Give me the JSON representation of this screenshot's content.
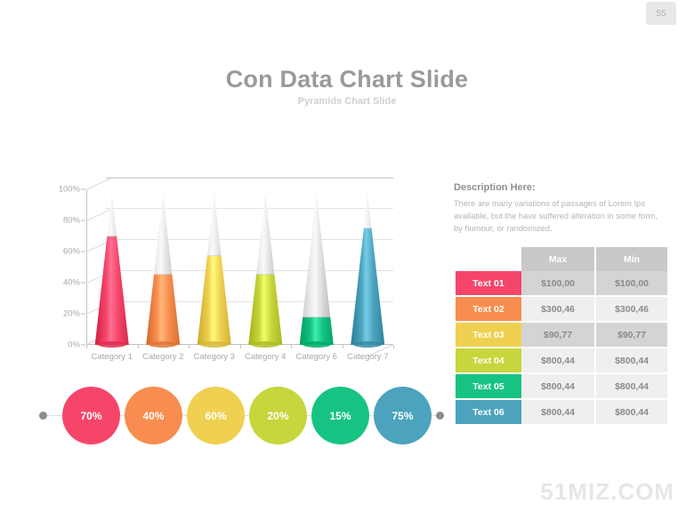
{
  "page_number": "55",
  "title": "Con Data Chart Slide",
  "subtitle": "Pyramids Chart Slide",
  "watermark": "51MIZ.COM",
  "description": {
    "heading": "Description Here:",
    "body": "There are many variations of passages  of Lorem Ips available, but the have suffered alteration in some form, by humour, or randomized."
  },
  "chart_data": {
    "type": "bar",
    "title": "Con Data Chart Slide",
    "subtitle": "Pyramids Chart Slide",
    "xlabel": "",
    "ylabel": "",
    "ylim": [
      0,
      100
    ],
    "ytick_labels": [
      "0%",
      "20%",
      "40%",
      "60%",
      "80%",
      "100%"
    ],
    "ytick_values": [
      0,
      20,
      40,
      60,
      80,
      100
    ],
    "grid": true,
    "legend": "none",
    "style": "3d-cone",
    "categories": [
      "Category 1",
      "Category 2",
      "Category 3",
      "Category 4",
      "Category 6",
      "Category 7"
    ],
    "values": [
      70,
      45,
      57,
      45,
      18,
      75
    ],
    "colors": [
      "#f5466a",
      "#f88d4f",
      "#efd050",
      "#c6d63c",
      "#17c383",
      "#4ca3bd"
    ]
  },
  "table": {
    "headers": [
      "",
      "Max",
      "Min"
    ],
    "rows": [
      {
        "label": "Text 01",
        "color": "#f5466a",
        "max": "$100,00",
        "min": "$100,00",
        "shade": "dark"
      },
      {
        "label": "Text 02",
        "color": "#f88d4f",
        "max": "$300,46",
        "min": "$300,46",
        "shade": "light"
      },
      {
        "label": "Text 03",
        "color": "#efd050",
        "max": "$90,77",
        "min": "$90,77",
        "shade": "dark"
      },
      {
        "label": "Text 04",
        "color": "#c6d63c",
        "max": "$800,44",
        "min": "$800,44",
        "shade": "light"
      },
      {
        "label": "Text 05",
        "color": "#17c383",
        "max": "$800,44",
        "min": "$800,44",
        "shade": "light"
      },
      {
        "label": "Text 06",
        "color": "#4ca3bd",
        "max": "$800,44",
        "min": "$800,44",
        "shade": "light"
      }
    ]
  },
  "circles": [
    {
      "label": "70%",
      "color": "#f5466a"
    },
    {
      "label": "40%",
      "color": "#f88d4f"
    },
    {
      "label": "60%",
      "color": "#efd050"
    },
    {
      "label": "20%",
      "color": "#c6d63c"
    },
    {
      "label": "15%",
      "color": "#17c383"
    },
    {
      "label": "75%",
      "color": "#4ca3bd"
    }
  ]
}
